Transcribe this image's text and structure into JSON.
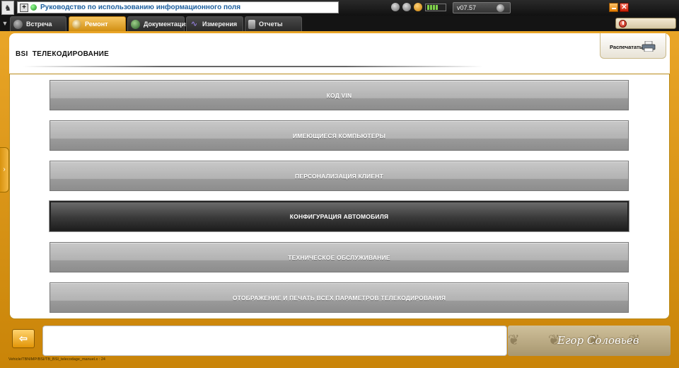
{
  "topbar": {
    "help_text": "Руководство по использованию информационного поля",
    "version": "v07.57"
  },
  "tabs": [
    {
      "label": "Встреча",
      "icon": "globe-icon"
    },
    {
      "label": "Ремонт",
      "icon": "wrench-icon",
      "active": true
    },
    {
      "label": "Документация",
      "icon": "book-icon"
    },
    {
      "label": "Измерения",
      "icon": "wave-icon"
    },
    {
      "label": "Отчеты",
      "icon": "report-icon"
    }
  ],
  "page": {
    "title": "BSI  ТЕЛЕКОДИРОВАНИЕ",
    "print_label": "Распечатать"
  },
  "menu": [
    {
      "label": "КОД VIN"
    },
    {
      "label": "ИМЕЮЩИЕСЯ КОМПЬЮТЕРЫ"
    },
    {
      "label": "ПЕРСОНАЛИЗАЦИЯ КЛИЕНТ"
    },
    {
      "label": "КОНФИГУРАЦИЯ АВТОМОБИЛЯ",
      "selected": true
    },
    {
      "label": "ТЕХНИЧЕСКОЕ ОБСЛУЖИВАНИЕ"
    },
    {
      "label": "ОТОБРАЖЕНИЕ И ПЕЧАТЬ ВСЕХ ПАРАМЕТРОВ ТЕЛЕКОДИРОВАНИЯ"
    }
  ],
  "bottom": {
    "signature": "Егор Соловьев",
    "status_path": "Vehicle/TBNIMP/BSI/TB_BSI_telecodage_manuel.x : 24"
  },
  "colors": {
    "accent": "#e39a1b",
    "selected_button": "#2b2b2b",
    "button": "#b0b0b0"
  }
}
